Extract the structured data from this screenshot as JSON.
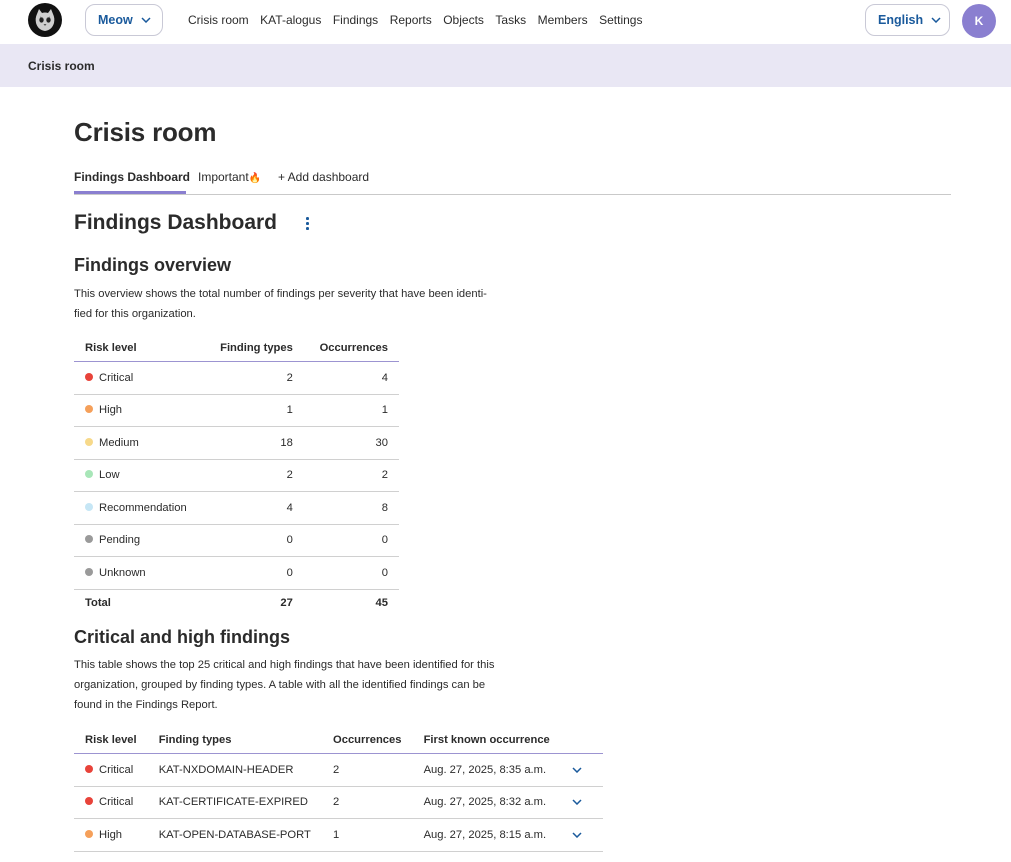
{
  "nav": {
    "org_name": "Meow",
    "menu": [
      "Crisis room",
      "KAT-alogus",
      "Findings",
      "Reports",
      "Objects",
      "Tasks",
      "Members",
      "Settings"
    ],
    "language": "English",
    "avatar_initial": "K"
  },
  "breadcrumb": "Crisis room",
  "page": {
    "title": "Crisis room",
    "tabs": {
      "findings_dashboard": "Findings Dashboard",
      "important": "Important",
      "important_emoji": "🔥",
      "add_dashboard": "+ Add dashboard"
    },
    "dashboard_title": "Findings Dashboard"
  },
  "overview": {
    "title": "Findings overview",
    "description_line1": "This overview shows the total number of findings per severity that have been identi-",
    "description_line2": "fied for this organization.",
    "columns": [
      "Risk level",
      "Finding types",
      "Occurrences"
    ],
    "rows": [
      {
        "level": "Critical",
        "types": "2",
        "occurrences": "4",
        "color": "#e8433a"
      },
      {
        "level": "High",
        "types": "1",
        "occurrences": "1",
        "color": "#f5a05a"
      },
      {
        "level": "Medium",
        "types": "18",
        "occurrences": "30",
        "color": "#f7d98a"
      },
      {
        "level": "Low",
        "types": "2",
        "occurrences": "2",
        "color": "#a8e6b8"
      },
      {
        "level": "Recommendation",
        "types": "4",
        "occurrences": "8",
        "color": "#c6e6f5"
      },
      {
        "level": "Pending",
        "types": "0",
        "occurrences": "0",
        "color": "#9a9a9a"
      },
      {
        "level": "Unknown",
        "types": "0",
        "occurrences": "0",
        "color": "#9a9a9a"
      }
    ],
    "total": {
      "label": "Total",
      "types": "27",
      "occurrences": "45"
    }
  },
  "critical": {
    "title": "Critical and high findings",
    "description_line1": "This table shows the top 25 critical and high findings that have been identified for this",
    "description_line2": "organization, grouped by finding types. A table with all the identified findings can be",
    "description_line3": "found in the Findings Report.",
    "columns": [
      "Risk level",
      "Finding types",
      "Occurrences",
      "First known occurrence"
    ],
    "rows": [
      {
        "level": "Critical",
        "type": "KAT-NXDOMAIN-HEADER",
        "occurrences": "2",
        "first": "Aug. 27, 2025, 8:35 a.m.",
        "color": "#e8433a"
      },
      {
        "level": "Critical",
        "type": "KAT-CERTIFICATE-EXPIRED",
        "occurrences": "2",
        "first": "Aug. 27, 2025, 8:32 a.m.",
        "color": "#e8433a"
      },
      {
        "level": "High",
        "type": "KAT-OPEN-DATABASE-PORT",
        "occurrences": "1",
        "first": "Aug. 27, 2025, 8:15 a.m.",
        "color": "#f5a05a"
      }
    ]
  }
}
